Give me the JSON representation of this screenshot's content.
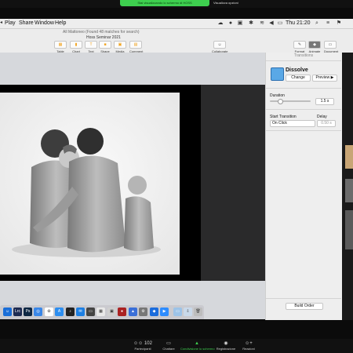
{
  "zoom_share": {
    "banner": "Stai visualizzando lo schermo di HOSS",
    "options": "Visualizza opzioni"
  },
  "menubar": {
    "items": [
      "Play",
      "Share",
      "Window",
      "Help"
    ],
    "status_icons": [
      "cloud-icon",
      "record-icon",
      "zoom-icon",
      "bluetooth-icon",
      "wifi-icon",
      "volume-icon",
      "battery-icon",
      "flag-icon"
    ],
    "clock": "Thu 21:20"
  },
  "keynote": {
    "find_status": "All Mattoneo (Found 48 matches for search)",
    "document_title": "Hoss Seminar 2021",
    "toolbar": {
      "table": "Table",
      "chart": "Chart",
      "text": "Text",
      "shape": "Shape",
      "media": "Media",
      "comment": "Comment",
      "collaborate": "Collaborate",
      "format": "Format",
      "animate": "Animate",
      "document": "Document"
    }
  },
  "inspector": {
    "header": "Transitions",
    "effect_name": "Dissolve",
    "change_label": "Change",
    "preview_label": "Preview ▶",
    "duration_label": "Duration",
    "duration_value": "1.5 s",
    "duration_fraction": 0.25,
    "start_label": "Start Transition",
    "start_value": "On Click",
    "delay_label": "Delay",
    "delay_value": "0.50 s",
    "build_order_label": "Build Order"
  },
  "zoom_controls": {
    "participants_count": "102",
    "participants": "Partecipanti",
    "chat": "Chattare",
    "share": "Condivisione lo schermo",
    "record": "Registrazione",
    "reactions": "Reazioni"
  },
  "colors": {
    "zoom_green": "#3ecf4f",
    "keynote_accent": "#f1a21c"
  }
}
